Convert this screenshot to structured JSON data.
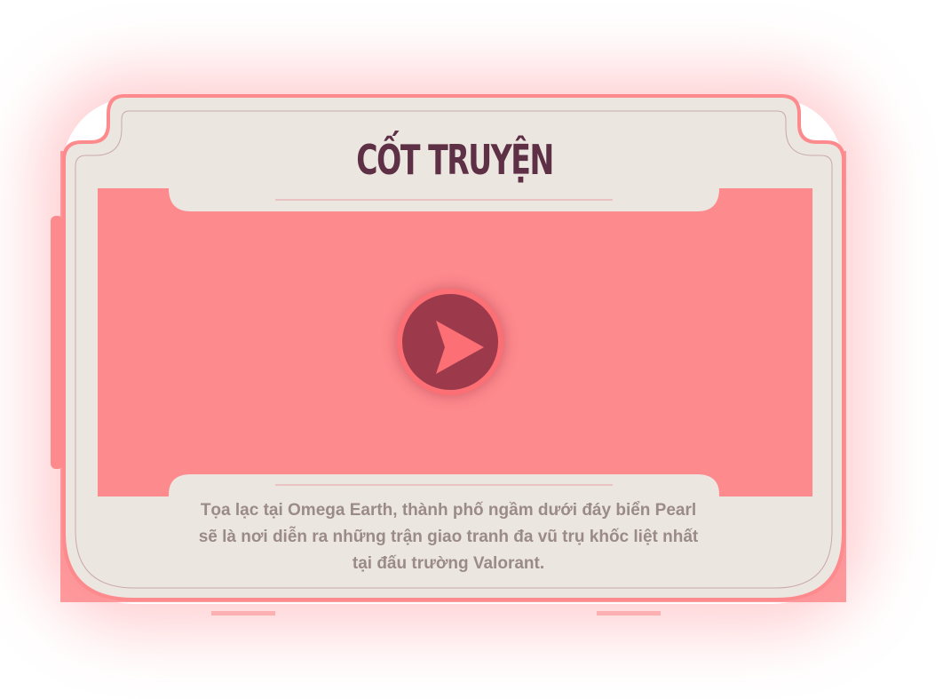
{
  "card": {
    "title": "CỐT TRUYỆN",
    "description_lines": [
      "Tọa lạc tại Omega Earth, thành phố ngầm dưới đáy biển Pearl",
      "sẽ là nơi diễn ra những trận giao tranh đa vũ trụ khốc liệt nhất",
      "tại đấu trường Valorant."
    ]
  },
  "video": {
    "play_icon": "play-icon"
  },
  "colors": {
    "frame_pink": "#fd8a8d",
    "panel_beige": "#ece6e1",
    "title_maroon": "#5e3046",
    "play_inner": "#9c3a4c",
    "play_ring": "#fc6f75",
    "text_gray": "#9b8b88"
  }
}
